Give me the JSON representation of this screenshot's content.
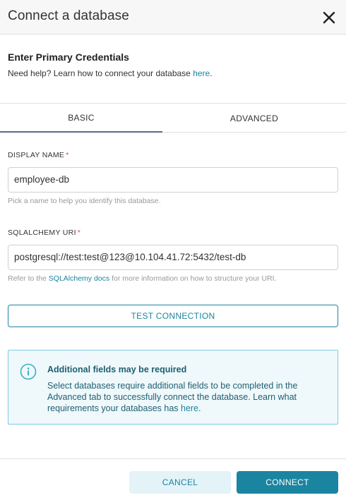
{
  "modal": {
    "title": "Connect a database"
  },
  "credentials": {
    "title": "Enter Primary Credentials",
    "help_text": "Need help? Learn how to connect your database ",
    "help_link": "here",
    "help_suffix": "."
  },
  "tabs": [
    {
      "label": "BASIC",
      "active": true
    },
    {
      "label": "ADVANCED",
      "active": false
    }
  ],
  "fields": {
    "display_name": {
      "label": "DISPLAY NAME",
      "required_mark": "*",
      "value": "employee-db",
      "helper": "Pick a name to help you identify this database."
    },
    "sqlalchemy_uri": {
      "label": "SQLALCHEMY URI",
      "required_mark": "*",
      "value": "postgresql://test:test@123@10.104.41.72:5432/test-db",
      "helper_prefix": "Refer to the ",
      "helper_link": "SQLAlchemy docs",
      "helper_suffix": " for more information on how to structure your URI."
    }
  },
  "test_button": "TEST CONNECTION",
  "alert": {
    "icon": "info-icon",
    "title": "Additional fields may be required",
    "body": "Select databases require additional fields to be completed in the Advanced tab to successfully connect the database. Learn what requirements your databases has ",
    "link": "here",
    "suffix": "."
  },
  "footer": {
    "cancel": "CANCEL",
    "connect": "CONNECT"
  },
  "colors": {
    "primary": "#1a85a0",
    "required": "#e04355",
    "alert_bg": "#eff8fb",
    "alert_border": "#7ccbe0"
  }
}
